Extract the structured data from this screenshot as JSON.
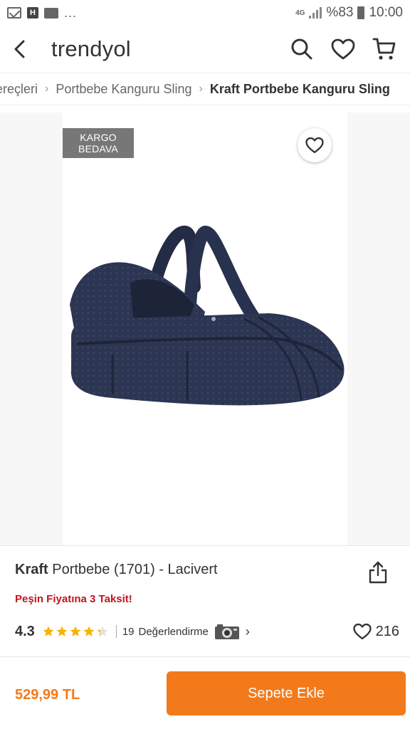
{
  "status_bar": {
    "network": "4G",
    "battery_percent": "%83",
    "time": "10:00",
    "h_badge": "H",
    "more": "..."
  },
  "header": {
    "brand": "trendyol"
  },
  "breadcrumb": {
    "items": [
      "ereçleri",
      "Portbebe Kanguru Sling"
    ],
    "current": "Kraft Portbebe Kanguru Sling"
  },
  "product": {
    "badge_line1": "KARGO",
    "badge_line2": "BEDAVA",
    "brand": "Kraft",
    "name": "Portbebe (1701) - Lacivert",
    "promo": "Peşin Fiyatına 3 Taksit!",
    "rating": "4.3",
    "rating_value": 4.3,
    "rating_max": 5,
    "review_count": "19",
    "review_label": "Değerlendirme",
    "likes": "216",
    "price": "529,99 TL"
  },
  "actions": {
    "add_to_cart": "Sepete Ekle"
  },
  "colors": {
    "accent": "#f27a1a",
    "promo": "#c0161e",
    "product_navy": "#2a3350"
  }
}
